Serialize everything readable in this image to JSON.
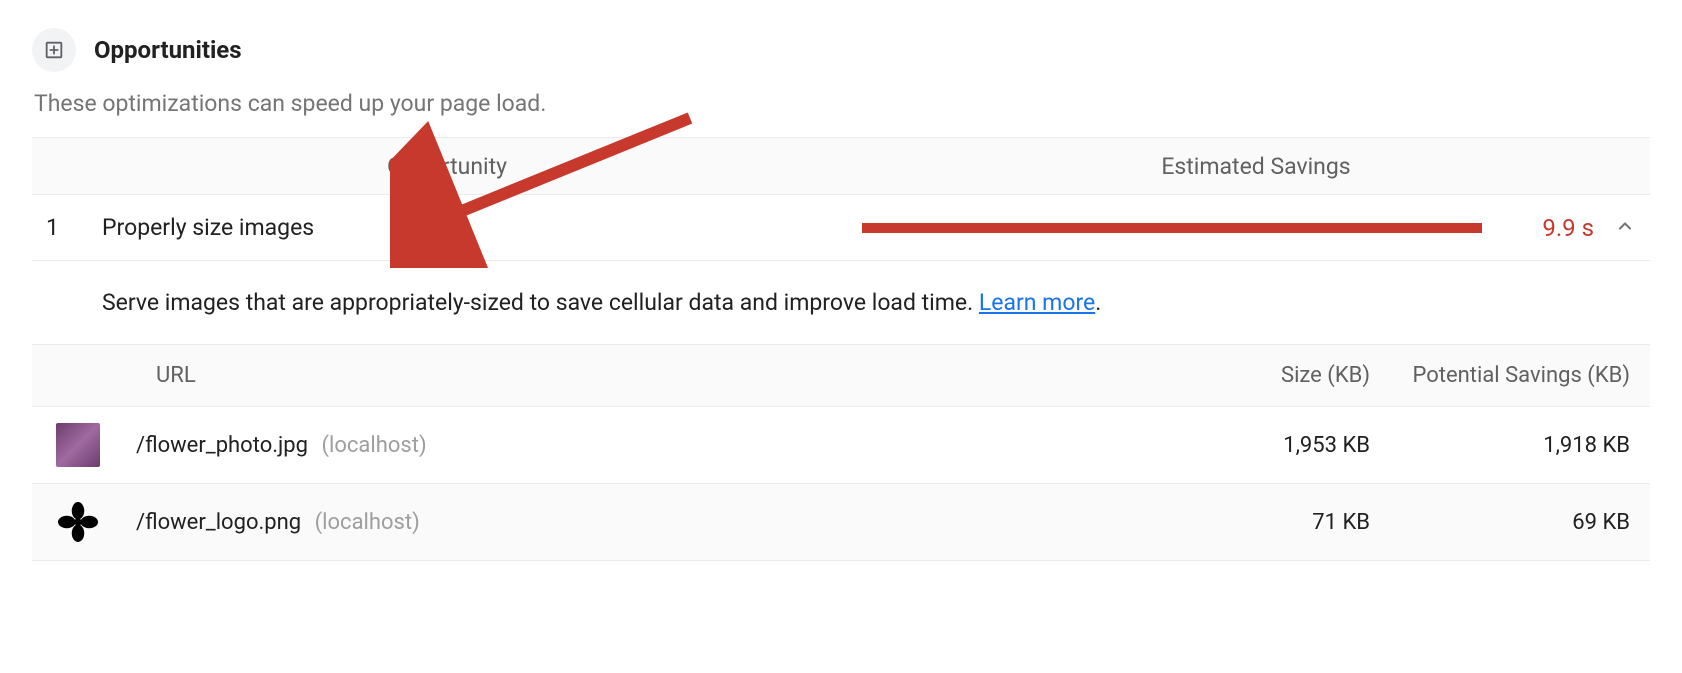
{
  "header": {
    "title": "Opportunities",
    "subtitle": "These optimizations can speed up your page load."
  },
  "columns": {
    "opportunity": "Opportunity",
    "estimated_savings": "Estimated Savings"
  },
  "opportunity": {
    "index": "1",
    "title": "Properly size images",
    "savings": "9.9 s",
    "bar_color": "#c7392d",
    "description_prefix": "Serve images that are appropriately-sized to save cellular data and improve load time. ",
    "learn_more": "Learn more",
    "description_suffix": "."
  },
  "details": {
    "headers": {
      "url": "URL",
      "size": "Size (KB)",
      "potential": "Potential Savings (KB)"
    },
    "rows": [
      {
        "thumb": "photo",
        "path": "/flower_photo.jpg",
        "host": "(localhost)",
        "size": "1,953 KB",
        "potential": "1,918 KB"
      },
      {
        "thumb": "logo",
        "path": "/flower_logo.png",
        "host": "(localhost)",
        "size": "71 KB",
        "potential": "69 KB"
      }
    ]
  }
}
